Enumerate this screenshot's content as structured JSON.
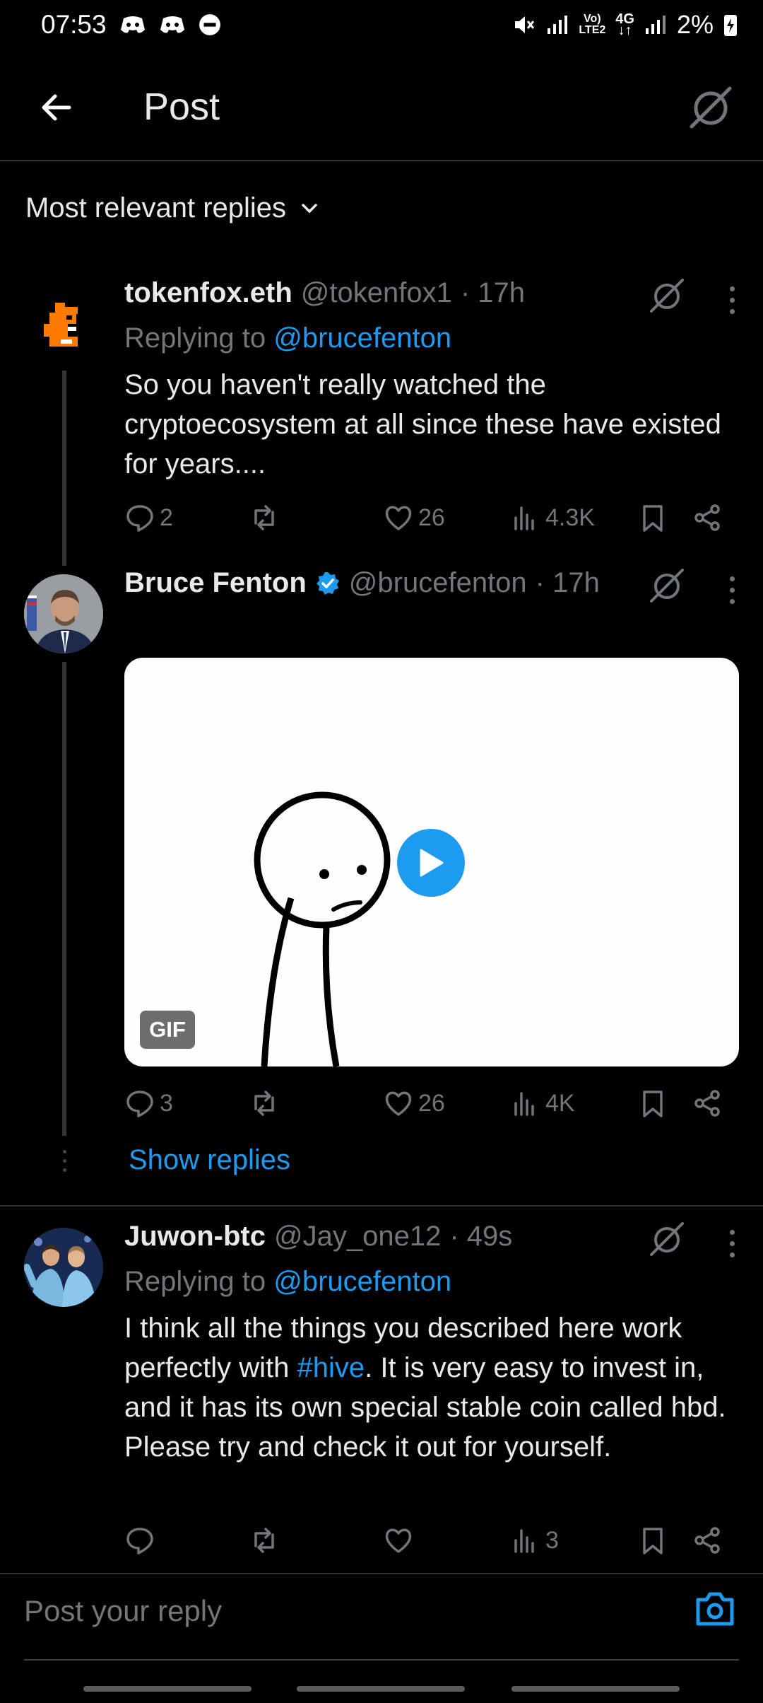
{
  "status_bar": {
    "time": "07:53",
    "network_top": "Vo)",
    "network_bottom": "LTE2",
    "network_type": "4G",
    "battery": "2%"
  },
  "header": {
    "title": "Post"
  },
  "sort": {
    "label": "Most relevant replies"
  },
  "posts": [
    {
      "name": "tokenfox.eth",
      "handle": "@tokenfox1",
      "time": "· 17h",
      "replying_prefix": "Replying to",
      "replying_to": "@brucefenton",
      "text": "So you haven't really watched the cryptoecosystem at all since these have existed for years....",
      "replies": "2",
      "reposts": "",
      "likes": "26",
      "views": "4.3K"
    },
    {
      "name": "Bruce Fenton",
      "handle": "@brucefenton",
      "time": "· 17h",
      "verified": true,
      "media_badge": "GIF",
      "replies": "3",
      "reposts": "",
      "likes": "26",
      "views": "4K",
      "show_replies": "Show replies"
    },
    {
      "name": "Juwon-btc",
      "handle": "@Jay_one12",
      "time": "· 49s",
      "replying_prefix": "Replying to",
      "replying_to": "@brucefenton",
      "text_before": "I think all the things you described here work perfectly with ",
      "hashtag": "#hive",
      "text_after": ". It is very easy to invest in, and it has its own special stable coin called hbd.   Please try and check it out for yourself.",
      "replies": "",
      "reposts": "",
      "likes": "",
      "views": "3"
    }
  ],
  "composer": {
    "placeholder": "Post your reply"
  },
  "colors": {
    "accent": "#1d9bf0",
    "background": "#000000",
    "muted": "#71767b",
    "divider": "#2f3336"
  }
}
